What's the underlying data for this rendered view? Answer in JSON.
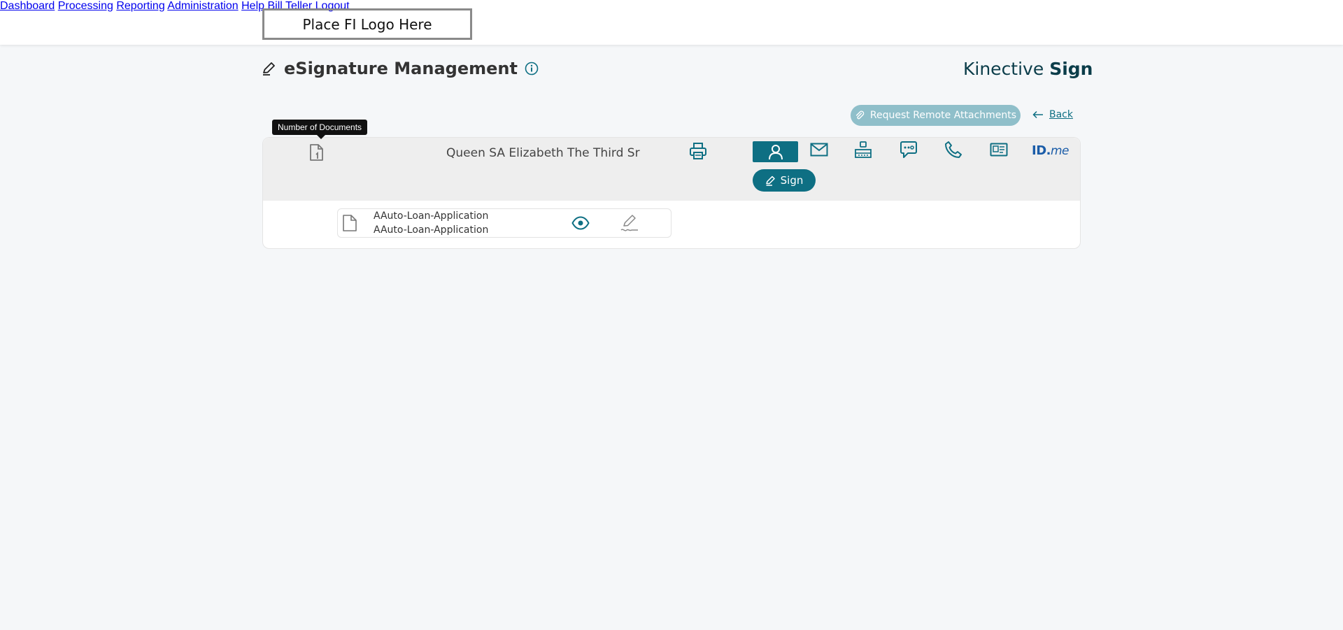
{
  "header": {
    "logo_text": "Place FI Logo Here",
    "nav": [
      "Dashboard",
      "Processing",
      "Reporting",
      "Administration",
      "Help",
      "Bill Teller",
      "Logout"
    ]
  },
  "page": {
    "title": "eSignature Management",
    "brand_light": "Kinective ",
    "brand_bold": "Sign",
    "remote_attachments_label": "Request Remote Attachments",
    "back_label": "Back"
  },
  "signer": {
    "tooltip": "Number of Documents",
    "name": "Queen SA Elizabeth The Third Sr",
    "sign_label": "Sign",
    "idme_bold": "ID.",
    "idme_italic": "me"
  },
  "documents": [
    {
      "title": "AAuto-Loan-Application",
      "subtitle": "AAuto-Loan-Application"
    }
  ],
  "colors": {
    "accent": "#0e6f83",
    "accent_muted": "#8fbfca",
    "idme_blue": "#1a5ca8"
  },
  "icons": [
    "edit-pen-icon",
    "info-icon",
    "paperclip-icon",
    "arrow-left-icon",
    "document-count-icon",
    "printer-icon",
    "person-icon",
    "envelope-icon",
    "router-icon",
    "chat-key-icon",
    "phone-icon",
    "id-card-icon",
    "document-icon",
    "eye-icon",
    "signature-icon"
  ]
}
